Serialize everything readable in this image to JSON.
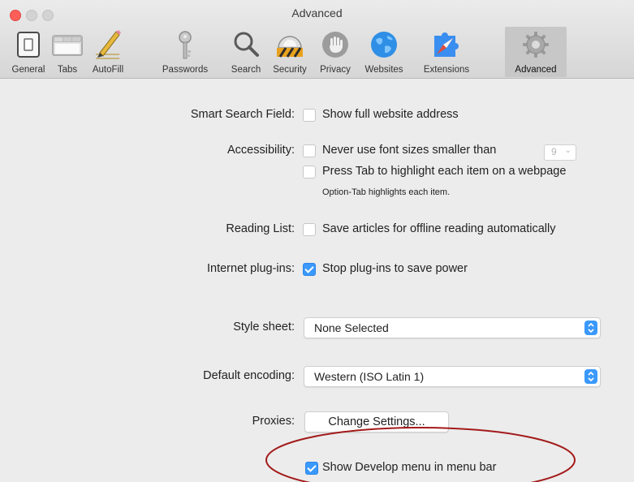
{
  "window": {
    "title": "Advanced"
  },
  "toolbar": {
    "tabs": [
      {
        "label": "General",
        "icon": "general-switch-icon"
      },
      {
        "label": "Tabs",
        "icon": "tabs-icon"
      },
      {
        "label": "AutoFill",
        "icon": "autofill-pencil-icon"
      },
      {
        "label": "Passwords",
        "icon": "key-icon"
      },
      {
        "label": "Search",
        "icon": "magnifier-icon"
      },
      {
        "label": "Security",
        "icon": "security-helmet-icon"
      },
      {
        "label": "Privacy",
        "icon": "hand-icon"
      },
      {
        "label": "Websites",
        "icon": "globe-icon"
      },
      {
        "label": "Extensions",
        "icon": "puzzle-icon"
      },
      {
        "label": "Advanced",
        "icon": "gear-icon"
      }
    ],
    "selected": "Advanced"
  },
  "settings": {
    "smart_search": {
      "label": "Smart Search Field:",
      "option": "Show full website address",
      "checked": false
    },
    "accessibility": {
      "label": "Accessibility:",
      "option1": "Never use font sizes smaller than",
      "option1_checked": false,
      "font_size": "9",
      "option2": "Press Tab to highlight each item on a webpage",
      "option2_checked": false,
      "note": "Option-Tab highlights each item."
    },
    "reading_list": {
      "label": "Reading List:",
      "option": "Save articles for offline reading automatically",
      "checked": false
    },
    "plugins": {
      "label": "Internet plug-ins:",
      "option": "Stop plug-ins to save power",
      "checked": true
    },
    "style_sheet": {
      "label": "Style sheet:",
      "value": "None Selected"
    },
    "encoding": {
      "label": "Default encoding:",
      "value": "Western (ISO Latin 1)"
    },
    "proxies": {
      "label": "Proxies:",
      "button": "Change Settings..."
    },
    "develop": {
      "option": "Show Develop menu in menu bar",
      "checked": true
    }
  },
  "colors": {
    "accent": "#3b99fc",
    "annotation": "#a31a1a"
  }
}
